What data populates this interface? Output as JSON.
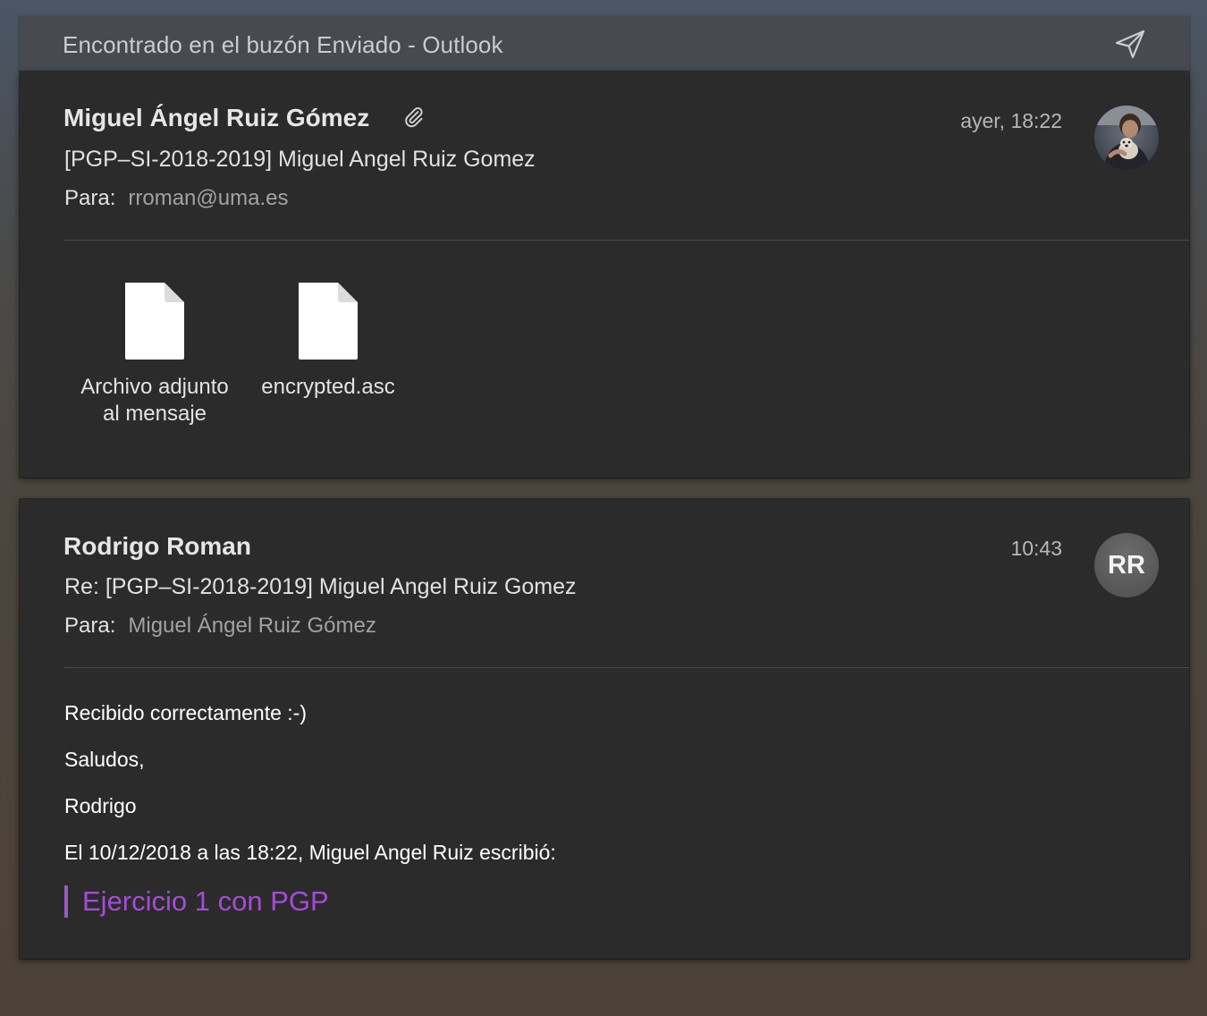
{
  "header": {
    "title": "Encontrado en el buzón Enviado - Outlook",
    "send_icon": "paper-plane-icon"
  },
  "messages": [
    {
      "sender": "Miguel Ángel Ruiz Gómez",
      "has_attachment_icon": "paperclip-icon",
      "time": "ayer, 18:22",
      "subject": "[PGP–SI-2018-2019] Miguel Angel Ruiz Gomez",
      "to_label": "Para:",
      "to_value": "rroman@uma.es",
      "avatar": "profile-photo",
      "attachments": [
        {
          "name_line1": "Archivo adjunto",
          "name_line2": "al mensaje",
          "icon": "file-icon"
        },
        {
          "name_line1": "encrypted.asc",
          "name_line2": "",
          "icon": "file-icon"
        }
      ]
    },
    {
      "sender": "Rodrigo Roman",
      "time": "10:43",
      "subject": "Re: [PGP–SI-2018-2019] Miguel Angel Ruiz Gomez",
      "to_label": "Para:",
      "to_value": "Miguel Ángel Ruiz Gómez",
      "avatar_initials": "RR",
      "body": [
        "Recibido correctamente :-)",
        "Saludos,",
        "Rodrigo",
        "El 10/12/2018 a las 18:22, Miguel Angel Ruiz escribió:"
      ],
      "quote": "Ejercicio 1 con PGP"
    }
  ],
  "colors": {
    "card_bg": "#2b2b2b",
    "header_bg": "#474b50",
    "quote_color": "#a64bd8",
    "quote_bar": "#9b59c9"
  }
}
